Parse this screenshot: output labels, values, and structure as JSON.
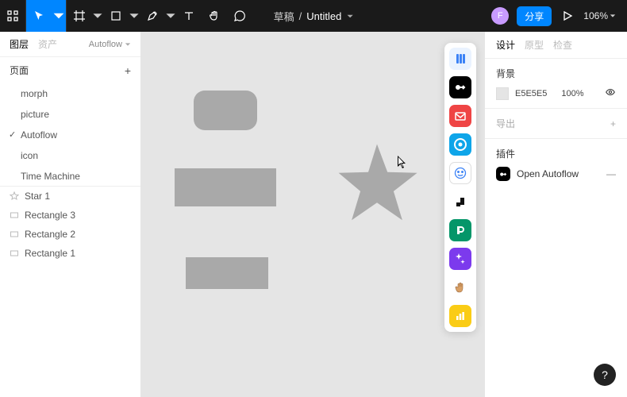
{
  "topbar": {
    "breadcrumb_prefix": "草稿",
    "breadcrumb_sep": "/",
    "title": "Untitled",
    "avatar_initial": "F",
    "share_label": "分享",
    "zoom": "106%"
  },
  "left": {
    "tab_layers": "图层",
    "tab_assets": "资产",
    "autoflow_label": "Autoflow",
    "pages_header": "页面",
    "pages": [
      {
        "name": "morph",
        "active": false
      },
      {
        "name": "picture",
        "active": false
      },
      {
        "name": "Autoflow",
        "active": true
      },
      {
        "name": "icon",
        "active": false
      },
      {
        "name": "Time Machine",
        "active": false
      }
    ],
    "layers": [
      {
        "icon": "star",
        "name": "Star 1"
      },
      {
        "icon": "rect",
        "name": "Rectangle 3"
      },
      {
        "icon": "rect",
        "name": "Rectangle 2"
      },
      {
        "icon": "rect-outline",
        "name": "Rectangle 1"
      }
    ]
  },
  "right": {
    "tab_design": "设计",
    "tab_prototype": "原型",
    "tab_inspect": "检查",
    "bg_header": "背景",
    "bg_hex": "E5E5E5",
    "bg_pct": "100%",
    "export_header": "导出",
    "plugins_header": "插件",
    "plugin_name": "Open Autoflow"
  },
  "dock_icons": [
    "layers",
    "autoflow",
    "mail",
    "record",
    "smile",
    "shape",
    "pexels",
    "wand",
    "hand-ok",
    "chart"
  ],
  "help": "?"
}
